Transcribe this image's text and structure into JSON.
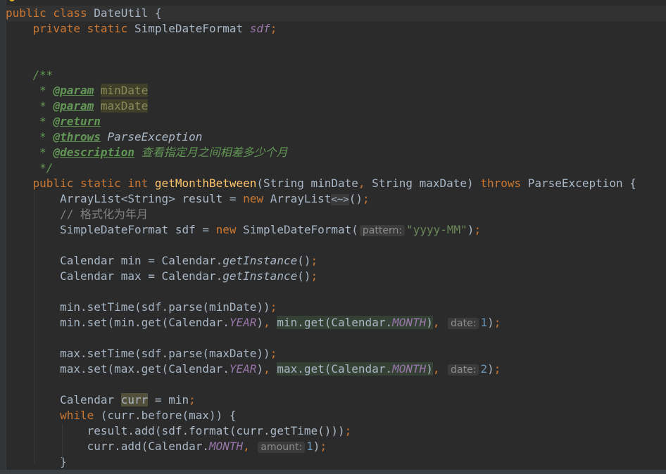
{
  "editor": {
    "lines": [
      {
        "segments": [
          [
            "kw",
            "public class "
          ],
          [
            "",
            "DateUtil {"
          ]
        ]
      },
      {
        "segments": [
          [
            "",
            "    "
          ],
          [
            "kw",
            "private static "
          ],
          [
            "",
            "SimpleDateFormat "
          ],
          [
            "fld",
            "sdf"
          ],
          [
            "kw",
            ";"
          ]
        ]
      },
      {
        "segments": []
      },
      {
        "segments": []
      },
      {
        "segments": [
          [
            "",
            "    "
          ],
          [
            "cm",
            "/**"
          ]
        ]
      },
      {
        "segments": [
          [
            "",
            "     "
          ],
          [
            "cm",
            "* "
          ],
          [
            "cmtag",
            "@param"
          ],
          [
            "cm",
            " "
          ],
          [
            "param-hl",
            "minDate"
          ]
        ]
      },
      {
        "segments": [
          [
            "",
            "     "
          ],
          [
            "cm",
            "* "
          ],
          [
            "cmtag",
            "@param"
          ],
          [
            "cm",
            " "
          ],
          [
            "param-hl",
            "maxDate"
          ]
        ]
      },
      {
        "segments": [
          [
            "",
            "     "
          ],
          [
            "cm",
            "* "
          ],
          [
            "cmtag",
            "@return"
          ]
        ]
      },
      {
        "segments": [
          [
            "",
            "     "
          ],
          [
            "cm",
            "* "
          ],
          [
            "cmtag",
            "@throws"
          ],
          [
            "cm",
            " "
          ],
          [
            "ital",
            "ParseException"
          ]
        ]
      },
      {
        "segments": [
          [
            "",
            "     "
          ],
          [
            "cm",
            "* "
          ],
          [
            "cmtag",
            "@description"
          ],
          [
            "cm",
            " 查看指定月之间相差多少个月"
          ]
        ]
      },
      {
        "segments": [
          [
            "",
            "     "
          ],
          [
            "cm",
            "*/"
          ]
        ]
      },
      {
        "segments": [
          [
            "",
            "    "
          ],
          [
            "kw",
            "public static int "
          ],
          [
            "fn",
            "getMonthBetween"
          ],
          [
            "",
            "(String minDate"
          ],
          [
            "kw",
            ", "
          ],
          [
            "",
            "String maxDate) "
          ],
          [
            "kw",
            "throws "
          ],
          [
            "",
            "ParseException {"
          ]
        ]
      },
      {
        "segments": [
          [
            "",
            "        ArrayList<String> result = "
          ],
          [
            "kw",
            "new "
          ],
          [
            "",
            "ArrayList"
          ],
          [
            "diam",
            "<~>"
          ],
          [
            "",
            "()"
          ],
          [
            "kw",
            ";"
          ]
        ]
      },
      {
        "segments": [
          [
            "",
            "        "
          ],
          [
            "lc",
            "// 格式化为年月"
          ]
        ]
      },
      {
        "segments": [
          [
            "",
            "        SimpleDateFormat sdf = "
          ],
          [
            "kw",
            "new "
          ],
          [
            "",
            "SimpleDateFormat("
          ],
          [
            "hint",
            "pattern:"
          ],
          [
            "str",
            "\"yyyy-MM\""
          ],
          [
            "",
            ")"
          ],
          [
            "kw",
            ";"
          ]
        ]
      },
      {
        "segments": []
      },
      {
        "segments": [
          [
            "",
            "        Calendar min = Calendar."
          ],
          [
            "ital",
            "getInstance"
          ],
          [
            "",
            "()"
          ],
          [
            "kw",
            ";"
          ]
        ]
      },
      {
        "segments": [
          [
            "",
            "        Calendar max = Calendar."
          ],
          [
            "ital",
            "getInstance"
          ],
          [
            "",
            "()"
          ],
          [
            "kw",
            ";"
          ]
        ]
      },
      {
        "segments": []
      },
      {
        "segments": [
          [
            "",
            "        min.setTime(sdf.parse(minDate))"
          ],
          [
            "kw",
            ";"
          ]
        ]
      },
      {
        "segments": [
          [
            "",
            "        min.set(min.get(Calendar."
          ],
          [
            "stat",
            "YEAR"
          ],
          [
            "",
            ")"
          ],
          [
            "kw",
            ", "
          ],
          [
            "occ",
            "min.get(Calendar."
          ],
          [
            "occstat",
            "MONTH"
          ],
          [
            "occ",
            ")"
          ],
          [
            "kw",
            ", "
          ],
          [
            "hint",
            "date:"
          ],
          [
            "num",
            "1"
          ],
          [
            "",
            ")"
          ],
          [
            "kw",
            ";"
          ]
        ]
      },
      {
        "segments": []
      },
      {
        "segments": [
          [
            "",
            "        max.setTime(sdf.parse(maxDate))"
          ],
          [
            "kw",
            ";"
          ]
        ]
      },
      {
        "segments": [
          [
            "",
            "        max.set(max.get(Calendar."
          ],
          [
            "stat",
            "YEAR"
          ],
          [
            "",
            ")"
          ],
          [
            "kw",
            ", "
          ],
          [
            "occ",
            "max.get(Calendar."
          ],
          [
            "occstat",
            "MONTH"
          ],
          [
            "occ",
            ")"
          ],
          [
            "kw",
            ", "
          ],
          [
            "hint",
            "date:"
          ],
          [
            "num",
            "2"
          ],
          [
            "",
            ")"
          ],
          [
            "kw",
            ";"
          ]
        ]
      },
      {
        "segments": []
      },
      {
        "segments": [
          [
            "",
            "        Calendar "
          ],
          [
            "var-hl",
            "curr"
          ],
          [
            "",
            " = min"
          ],
          [
            "kw",
            ";"
          ]
        ]
      },
      {
        "segments": [
          [
            "",
            "        "
          ],
          [
            "kw",
            "while "
          ],
          [
            "",
            "(curr.before(max)) {"
          ]
        ]
      },
      {
        "segments": [
          [
            "",
            "            result.add(sdf.format(curr.getTime()))"
          ],
          [
            "kw",
            ";"
          ]
        ]
      },
      {
        "segments": [
          [
            "",
            "            curr.add(Calendar."
          ],
          [
            "stat",
            "MONTH"
          ],
          [
            "kw",
            ", "
          ],
          [
            "hint",
            "amount:"
          ],
          [
            "num",
            "1"
          ],
          [
            "",
            ")"
          ],
          [
            "kw",
            ";"
          ]
        ]
      },
      {
        "segments": [
          [
            "",
            "        }"
          ]
        ]
      }
    ]
  },
  "colors": {
    "background": "#2b2b2b",
    "keyword": "#cc7832",
    "method_decl": "#ffc66d",
    "doc_comment": "#629755",
    "string": "#6a8759",
    "number": "#6897bb",
    "static_field": "#9876aa"
  },
  "icons": {
    "bulb": "intention-bulb-icon"
  }
}
